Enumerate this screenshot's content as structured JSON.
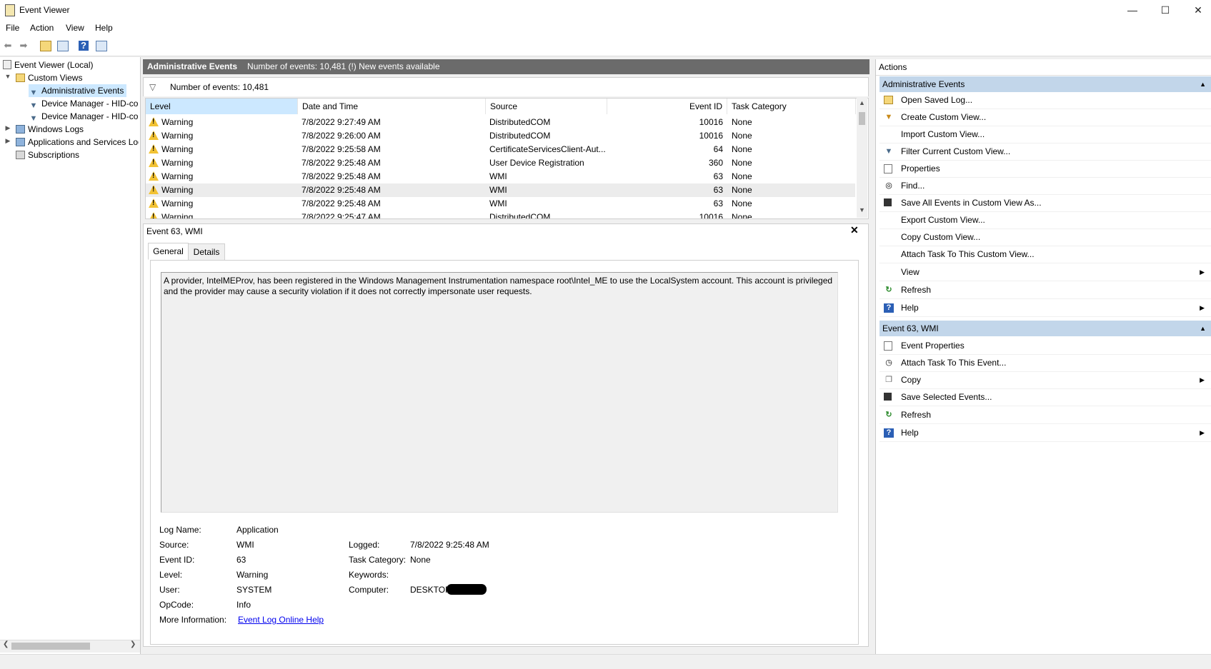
{
  "window": {
    "title": "Event Viewer",
    "min": "—",
    "max": "☐",
    "close": "✕"
  },
  "menu": [
    "File",
    "Action",
    "View",
    "Help"
  ],
  "tree": {
    "root": "Event Viewer (Local)",
    "custom_views": "Custom Views",
    "admin_events": "Administrative Events",
    "device1": "Device Manager - HID-compliant",
    "device2": "Device Manager - HID-compliant",
    "windows_logs": "Windows Logs",
    "apps_services": "Applications and Services Logs",
    "subscriptions": "Subscriptions"
  },
  "center": {
    "header_title": "Administrative Events",
    "header_info": "Number of events: 10,481 (!) New events available",
    "filter_text": "Number of events: 10,481"
  },
  "grid": {
    "columns": [
      "Level",
      "Date and Time",
      "Source",
      "Event ID",
      "Task Category"
    ],
    "rows": [
      {
        "level": "Warning",
        "date": "7/8/2022 9:27:49 AM",
        "source": "DistributedCOM",
        "id": "10016",
        "cat": "None"
      },
      {
        "level": "Warning",
        "date": "7/8/2022 9:26:00 AM",
        "source": "DistributedCOM",
        "id": "10016",
        "cat": "None"
      },
      {
        "level": "Warning",
        "date": "7/8/2022 9:25:58 AM",
        "source": "CertificateServicesClient-Aut...",
        "id": "64",
        "cat": "None"
      },
      {
        "level": "Warning",
        "date": "7/8/2022 9:25:48 AM",
        "source": "User Device Registration",
        "id": "360",
        "cat": "None"
      },
      {
        "level": "Warning",
        "date": "7/8/2022 9:25:48 AM",
        "source": "WMI",
        "id": "63",
        "cat": "None"
      },
      {
        "level": "Warning",
        "date": "7/8/2022 9:25:48 AM",
        "source": "WMI",
        "id": "63",
        "cat": "None"
      },
      {
        "level": "Warning",
        "date": "7/8/2022 9:25:48 AM",
        "source": "WMI",
        "id": "63",
        "cat": "None"
      },
      {
        "level": "Warning",
        "date": "7/8/2022 9:25:47 AM",
        "source": "DistributedCOM",
        "id": "10016",
        "cat": "None"
      }
    ]
  },
  "detail": {
    "title": "Event 63, WMI",
    "tabs": [
      "General",
      "Details"
    ],
    "message": "A provider, IntelMEProv, has been registered in the Windows Management Instrumentation namespace root\\Intel_ME to use the LocalSystem account. This account is privileged and the provider may cause a security violation if it does not correctly impersonate user requests.",
    "labels": {
      "log_name": "Log Name:",
      "source": "Source:",
      "event_id": "Event ID:",
      "level": "Level:",
      "user": "User:",
      "opcode": "OpCode:",
      "more_info": "More Information:",
      "logged": "Logged:",
      "task_category": "Task Category:",
      "keywords": "Keywords:",
      "computer": "Computer:"
    },
    "values": {
      "log_name": "Application",
      "source": "WMI",
      "event_id": "63",
      "level": "Warning",
      "user": "SYSTEM",
      "opcode": "Info",
      "more_info": "Event Log Online Help",
      "logged": "7/8/2022 9:25:48 AM",
      "task_category": "None",
      "keywords": "",
      "computer": "DESKTOP-"
    }
  },
  "actions": {
    "header": "Actions",
    "section1": "Administrative Events",
    "items1": [
      "Open Saved Log...",
      "Create Custom View...",
      "Import Custom View...",
      "Filter Current Custom View...",
      "Properties",
      "Find...",
      "Save All Events in Custom View As...",
      "Export Custom View...",
      "Copy Custom View...",
      "Attach Task To This Custom View...",
      "View",
      "Refresh",
      "Help"
    ],
    "section2": "Event 63, WMI",
    "items2": [
      "Event Properties",
      "Attach Task To This Event...",
      "Copy",
      "Save Selected Events...",
      "Refresh",
      "Help"
    ]
  }
}
